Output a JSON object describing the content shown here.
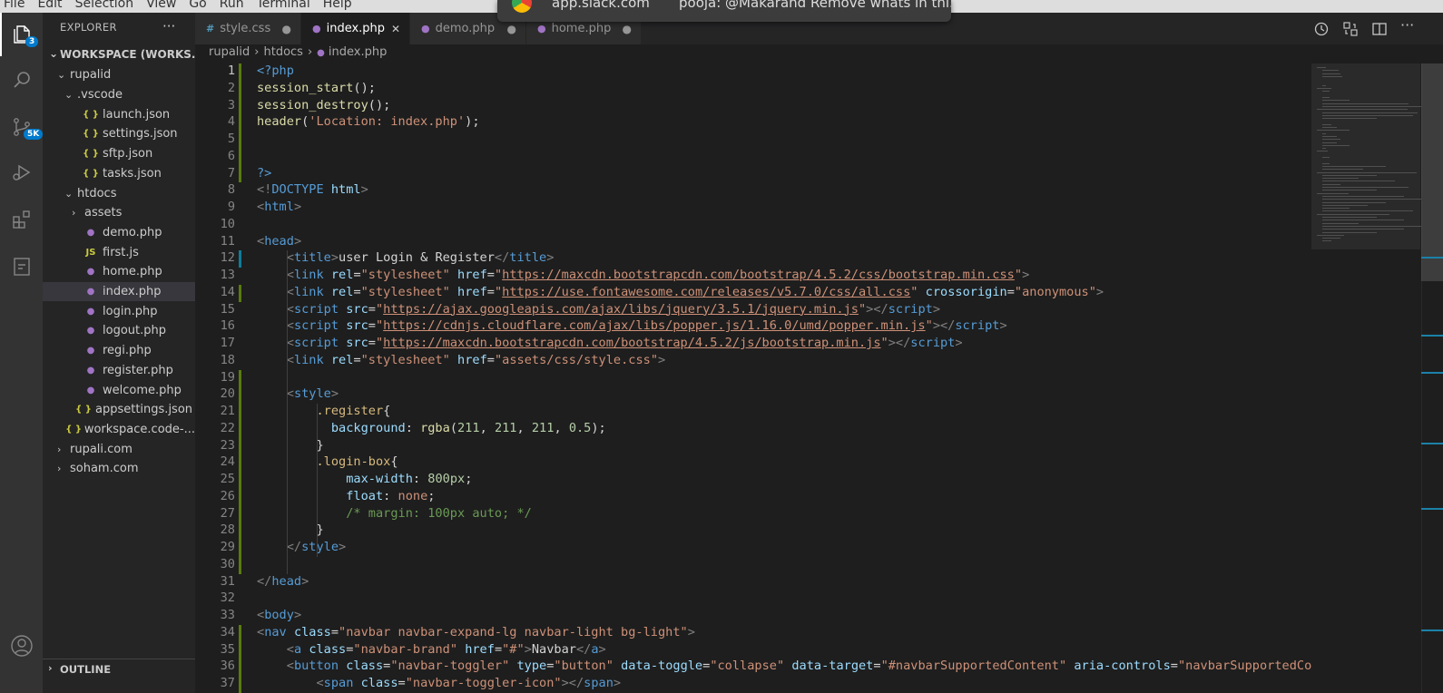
{
  "menu": [
    "File",
    "Edit",
    "Selection",
    "View",
    "Go",
    "Run",
    "Terminal",
    "Help"
  ],
  "notification": {
    "site": "app.slack.com",
    "message": "pooja: @Makarand Remove whats in thi..."
  },
  "activity_bar": {
    "explorer_badge": "3",
    "scm_badge": "5K"
  },
  "sidebar": {
    "title": "EXPLORER",
    "more": "···",
    "workspace": "WORKSPACE (WORKS...",
    "items": [
      {
        "label": "rupalid",
        "kind": "folder",
        "open": true,
        "depth": 1
      },
      {
        "label": ".vscode",
        "kind": "folder",
        "open": true,
        "depth": 2
      },
      {
        "label": "launch.json",
        "kind": "json",
        "depth": 3
      },
      {
        "label": "settings.json",
        "kind": "json",
        "depth": 3
      },
      {
        "label": "sftp.json",
        "kind": "json",
        "depth": 3
      },
      {
        "label": "tasks.json",
        "kind": "json",
        "depth": 3
      },
      {
        "label": "htdocs",
        "kind": "folder",
        "open": true,
        "depth": 2
      },
      {
        "label": "assets",
        "kind": "folder",
        "open": false,
        "depth": 3
      },
      {
        "label": "demo.php",
        "kind": "php",
        "depth": 3
      },
      {
        "label": "first.js",
        "kind": "js",
        "depth": 3
      },
      {
        "label": "home.php",
        "kind": "php",
        "depth": 3
      },
      {
        "label": "index.php",
        "kind": "php",
        "depth": 3,
        "selected": true
      },
      {
        "label": "login.php",
        "kind": "php",
        "depth": 3
      },
      {
        "label": "logout.php",
        "kind": "php",
        "depth": 3
      },
      {
        "label": "regi.php",
        "kind": "php",
        "depth": 3
      },
      {
        "label": "register.php",
        "kind": "php",
        "depth": 3
      },
      {
        "label": "welcome.php",
        "kind": "php",
        "depth": 3
      },
      {
        "label": "appsettings.json",
        "kind": "json",
        "depth": 2
      },
      {
        "label": "workspace.code-...",
        "kind": "json",
        "depth": 2
      },
      {
        "label": "rupali.com",
        "kind": "folder",
        "open": false,
        "depth": 1
      },
      {
        "label": "soham.com",
        "kind": "folder",
        "open": false,
        "depth": 1
      }
    ],
    "outline": "OUTLINE"
  },
  "tabs": [
    {
      "label": "style.css",
      "icon": "#",
      "active": false
    },
    {
      "label": "index.php",
      "icon": "php",
      "active": true
    },
    {
      "label": "demo.php",
      "icon": "php",
      "active": false
    },
    {
      "label": "home.php",
      "icon": "php",
      "active": false
    }
  ],
  "breadcrumb": [
    "rupalid",
    "htdocs",
    "index.php"
  ],
  "code_lines": [
    {
      "n": "1",
      "g": "add",
      "t": [
        [
          "t-tag",
          "<?php"
        ]
      ]
    },
    {
      "n": "2",
      "g": "add",
      "t": [
        [
          "t-fn",
          "session_start"
        ],
        [
          "t-txt",
          "();"
        ]
      ]
    },
    {
      "n": "3",
      "g": "add",
      "t": [
        [
          "t-fn",
          "session_destroy"
        ],
        [
          "t-txt",
          "();"
        ]
      ]
    },
    {
      "n": "4",
      "g": "add",
      "t": [
        [
          "t-fn",
          "header"
        ],
        [
          "t-txt",
          "("
        ],
        [
          "t-str",
          "'Location: index.php'"
        ],
        [
          "t-txt",
          ");"
        ]
      ]
    },
    {
      "n": "5",
      "g": "add",
      "t": []
    },
    {
      "n": "6",
      "g": "add",
      "t": []
    },
    {
      "n": "7",
      "g": "add",
      "t": [
        [
          "t-tag",
          "?>"
        ]
      ]
    },
    {
      "n": "8",
      "g": "",
      "t": [
        [
          "t-br",
          "<!"
        ],
        [
          "t-tag",
          "DOCTYPE"
        ],
        [
          "t-txt",
          " "
        ],
        [
          "t-attr",
          "html"
        ],
        [
          "t-br",
          ">"
        ]
      ]
    },
    {
      "n": "9",
      "g": "",
      "t": [
        [
          "t-br",
          "<"
        ],
        [
          "t-tag",
          "html"
        ],
        [
          "t-br",
          ">"
        ]
      ]
    },
    {
      "n": "10",
      "g": "",
      "t": []
    },
    {
      "n": "11",
      "g": "",
      "t": [
        [
          "t-br",
          "<"
        ],
        [
          "t-tag",
          "head"
        ],
        [
          "t-br",
          ">"
        ]
      ]
    },
    {
      "n": "12",
      "g": "mod",
      "t": [
        [
          "t-txt",
          "    "
        ],
        [
          "t-br",
          "<"
        ],
        [
          "t-tag",
          "title"
        ],
        [
          "t-br",
          ">"
        ],
        [
          "t-txt",
          "user Login & Register"
        ],
        [
          "t-br",
          "</"
        ],
        [
          "t-tag",
          "title"
        ],
        [
          "t-br",
          ">"
        ]
      ]
    },
    {
      "n": "13",
      "g": "",
      "t": [
        [
          "t-txt",
          "    "
        ],
        [
          "t-br",
          "<"
        ],
        [
          "t-tag",
          "link"
        ],
        [
          "t-txt",
          " "
        ],
        [
          "t-attr",
          "rel"
        ],
        [
          "t-txt",
          "="
        ],
        [
          "t-str",
          "\"stylesheet\""
        ],
        [
          "t-txt",
          " "
        ],
        [
          "t-attr",
          "href"
        ],
        [
          "t-txt",
          "="
        ],
        [
          "t-str",
          "\""
        ],
        [
          "t-url",
          "https://maxcdn.bootstrapcdn.com/bootstrap/4.5.2/css/bootstrap.min.css"
        ],
        [
          "t-str",
          "\""
        ],
        [
          "t-br",
          ">"
        ]
      ]
    },
    {
      "n": "14",
      "g": "add",
      "t": [
        [
          "t-txt",
          "    "
        ],
        [
          "t-br",
          "<"
        ],
        [
          "t-tag",
          "link"
        ],
        [
          "t-txt",
          " "
        ],
        [
          "t-attr",
          "rel"
        ],
        [
          "t-txt",
          "="
        ],
        [
          "t-str",
          "\"stylesheet\""
        ],
        [
          "t-txt",
          " "
        ],
        [
          "t-attr",
          "href"
        ],
        [
          "t-txt",
          "="
        ],
        [
          "t-str",
          "\""
        ],
        [
          "t-url",
          "https://use.fontawesome.com/releases/v5.7.0/css/all.css"
        ],
        [
          "t-str",
          "\""
        ],
        [
          "t-txt",
          " "
        ],
        [
          "t-attr",
          "crossorigin"
        ],
        [
          "t-txt",
          "="
        ],
        [
          "t-str",
          "\"anonymous\""
        ],
        [
          "t-br",
          ">"
        ]
      ]
    },
    {
      "n": "15",
      "g": "",
      "t": [
        [
          "t-txt",
          "    "
        ],
        [
          "t-br",
          "<"
        ],
        [
          "t-tag",
          "script"
        ],
        [
          "t-txt",
          " "
        ],
        [
          "t-attr",
          "src"
        ],
        [
          "t-txt",
          "="
        ],
        [
          "t-str",
          "\""
        ],
        [
          "t-url",
          "https://ajax.googleapis.com/ajax/libs/jquery/3.5.1/jquery.min.js"
        ],
        [
          "t-str",
          "\""
        ],
        [
          "t-br",
          "></"
        ],
        [
          "t-tag",
          "script"
        ],
        [
          "t-br",
          ">"
        ]
      ]
    },
    {
      "n": "16",
      "g": "",
      "t": [
        [
          "t-txt",
          "    "
        ],
        [
          "t-br",
          "<"
        ],
        [
          "t-tag",
          "script"
        ],
        [
          "t-txt",
          " "
        ],
        [
          "t-attr",
          "src"
        ],
        [
          "t-txt",
          "="
        ],
        [
          "t-str",
          "\""
        ],
        [
          "t-url",
          "https://cdnjs.cloudflare.com/ajax/libs/popper.js/1.16.0/umd/popper.min.js"
        ],
        [
          "t-str",
          "\""
        ],
        [
          "t-br",
          "></"
        ],
        [
          "t-tag",
          "script"
        ],
        [
          "t-br",
          ">"
        ]
      ]
    },
    {
      "n": "17",
      "g": "",
      "t": [
        [
          "t-txt",
          "    "
        ],
        [
          "t-br",
          "<"
        ],
        [
          "t-tag",
          "script"
        ],
        [
          "t-txt",
          " "
        ],
        [
          "t-attr",
          "src"
        ],
        [
          "t-txt",
          "="
        ],
        [
          "t-str",
          "\""
        ],
        [
          "t-url",
          "https://maxcdn.bootstrapcdn.com/bootstrap/4.5.2/js/bootstrap.min.js"
        ],
        [
          "t-str",
          "\""
        ],
        [
          "t-br",
          "></"
        ],
        [
          "t-tag",
          "script"
        ],
        [
          "t-br",
          ">"
        ]
      ]
    },
    {
      "n": "18",
      "g": "",
      "t": [
        [
          "t-txt",
          "    "
        ],
        [
          "t-br",
          "<"
        ],
        [
          "t-tag",
          "link"
        ],
        [
          "t-txt",
          " "
        ],
        [
          "t-attr",
          "rel"
        ],
        [
          "t-txt",
          "="
        ],
        [
          "t-str",
          "\"stylesheet\""
        ],
        [
          "t-txt",
          " "
        ],
        [
          "t-attr",
          "href"
        ],
        [
          "t-txt",
          "="
        ],
        [
          "t-str",
          "\"assets/css/style.css\""
        ],
        [
          "t-br",
          ">"
        ]
      ]
    },
    {
      "n": "19",
      "g": "add",
      "t": []
    },
    {
      "n": "20",
      "g": "add",
      "t": [
        [
          "t-txt",
          "    "
        ],
        [
          "t-br",
          "<"
        ],
        [
          "t-tag",
          "style"
        ],
        [
          "t-br",
          ">"
        ]
      ]
    },
    {
      "n": "21",
      "g": "add",
      "t": [
        [
          "t-txt",
          "        "
        ],
        [
          "t-sel",
          ".register"
        ],
        [
          "t-txt",
          "{"
        ]
      ]
    },
    {
      "n": "22",
      "g": "add",
      "t": [
        [
          "t-txt",
          "          "
        ],
        [
          "t-attr",
          "background"
        ],
        [
          "t-txt",
          ": "
        ],
        [
          "t-fn",
          "rgba"
        ],
        [
          "t-txt",
          "("
        ],
        [
          "t-num",
          "211"
        ],
        [
          "t-txt",
          ", "
        ],
        [
          "t-num",
          "211"
        ],
        [
          "t-txt",
          ", "
        ],
        [
          "t-num",
          "211"
        ],
        [
          "t-txt",
          ", "
        ],
        [
          "t-num",
          "0.5"
        ],
        [
          "t-txt",
          ");"
        ]
      ]
    },
    {
      "n": "23",
      "g": "add",
      "t": [
        [
          "t-txt",
          "        }"
        ]
      ]
    },
    {
      "n": "24",
      "g": "add",
      "t": [
        [
          "t-txt",
          "        "
        ],
        [
          "t-sel",
          ".login-box"
        ],
        [
          "t-txt",
          "{"
        ]
      ]
    },
    {
      "n": "25",
      "g": "add",
      "t": [
        [
          "t-txt",
          "            "
        ],
        [
          "t-attr",
          "max-width"
        ],
        [
          "t-txt",
          ": "
        ],
        [
          "t-num",
          "800px"
        ],
        [
          "t-txt",
          ";"
        ]
      ]
    },
    {
      "n": "26",
      "g": "add",
      "t": [
        [
          "t-txt",
          "            "
        ],
        [
          "t-attr",
          "float"
        ],
        [
          "t-txt",
          ": "
        ],
        [
          "t-str",
          "none"
        ],
        [
          "t-txt",
          ";"
        ]
      ]
    },
    {
      "n": "27",
      "g": "add",
      "t": [
        [
          "t-txt",
          "            "
        ],
        [
          "t-cm",
          "/* margin: 100px auto; */"
        ]
      ]
    },
    {
      "n": "28",
      "g": "add",
      "t": [
        [
          "t-txt",
          "        }"
        ]
      ]
    },
    {
      "n": "29",
      "g": "add",
      "t": [
        [
          "t-txt",
          "    "
        ],
        [
          "t-br",
          "</"
        ],
        [
          "t-tag",
          "style"
        ],
        [
          "t-br",
          ">"
        ]
      ]
    },
    {
      "n": "30",
      "g": "add",
      "t": []
    },
    {
      "n": "31",
      "g": "",
      "t": [
        [
          "t-br",
          "</"
        ],
        [
          "t-tag",
          "head"
        ],
        [
          "t-br",
          ">"
        ]
      ]
    },
    {
      "n": "32",
      "g": "",
      "t": []
    },
    {
      "n": "33",
      "g": "",
      "t": [
        [
          "t-br",
          "<"
        ],
        [
          "t-tag",
          "body"
        ],
        [
          "t-br",
          ">"
        ]
      ]
    },
    {
      "n": "34",
      "g": "add",
      "t": [
        [
          "t-br",
          "<"
        ],
        [
          "t-tag",
          "nav"
        ],
        [
          "t-txt",
          " "
        ],
        [
          "t-attr",
          "class"
        ],
        [
          "t-txt",
          "="
        ],
        [
          "t-str",
          "\"navbar navbar-expand-lg navbar-light bg-light\""
        ],
        [
          "t-br",
          ">"
        ]
      ]
    },
    {
      "n": "35",
      "g": "add",
      "t": [
        [
          "t-txt",
          "    "
        ],
        [
          "t-br",
          "<"
        ],
        [
          "t-tag",
          "a"
        ],
        [
          "t-txt",
          " "
        ],
        [
          "t-attr",
          "class"
        ],
        [
          "t-txt",
          "="
        ],
        [
          "t-str",
          "\"navbar-brand\""
        ],
        [
          "t-txt",
          " "
        ],
        [
          "t-attr",
          "href"
        ],
        [
          "t-txt",
          "="
        ],
        [
          "t-str",
          "\"#\""
        ],
        [
          "t-br",
          ">"
        ],
        [
          "t-txt",
          "Navbar"
        ],
        [
          "t-br",
          "</"
        ],
        [
          "t-tag",
          "a"
        ],
        [
          "t-br",
          ">"
        ]
      ]
    },
    {
      "n": "36",
      "g": "add",
      "t": [
        [
          "t-txt",
          "    "
        ],
        [
          "t-br",
          "<"
        ],
        [
          "t-tag",
          "button"
        ],
        [
          "t-txt",
          " "
        ],
        [
          "t-attr",
          "class"
        ],
        [
          "t-txt",
          "="
        ],
        [
          "t-str",
          "\"navbar-toggler\""
        ],
        [
          "t-txt",
          " "
        ],
        [
          "t-attr",
          "type"
        ],
        [
          "t-txt",
          "="
        ],
        [
          "t-str",
          "\"button\""
        ],
        [
          "t-txt",
          " "
        ],
        [
          "t-attr",
          "data-toggle"
        ],
        [
          "t-txt",
          "="
        ],
        [
          "t-str",
          "\"collapse\""
        ],
        [
          "t-txt",
          " "
        ],
        [
          "t-attr",
          "data-target"
        ],
        [
          "t-txt",
          "="
        ],
        [
          "t-str",
          "\"#navbarSupportedContent\""
        ],
        [
          "t-txt",
          " "
        ],
        [
          "t-attr",
          "aria-controls"
        ],
        [
          "t-txt",
          "="
        ],
        [
          "t-str",
          "\"navbarSupportedContent\""
        ]
      ]
    },
    {
      "n": "37",
      "g": "add",
      "t": [
        [
          "t-txt",
          "        "
        ],
        [
          "t-br",
          "<"
        ],
        [
          "t-tag",
          "span"
        ],
        [
          "t-txt",
          " "
        ],
        [
          "t-attr",
          "class"
        ],
        [
          "t-txt",
          "="
        ],
        [
          "t-str",
          "\"navbar-toggler-icon\""
        ],
        [
          "t-br",
          "></"
        ],
        [
          "t-tag",
          "span"
        ],
        [
          "t-br",
          ">"
        ]
      ]
    }
  ],
  "colors": {
    "accent": "#007acc",
    "added": "#587c0c",
    "modified": "#0c7d9d"
  }
}
